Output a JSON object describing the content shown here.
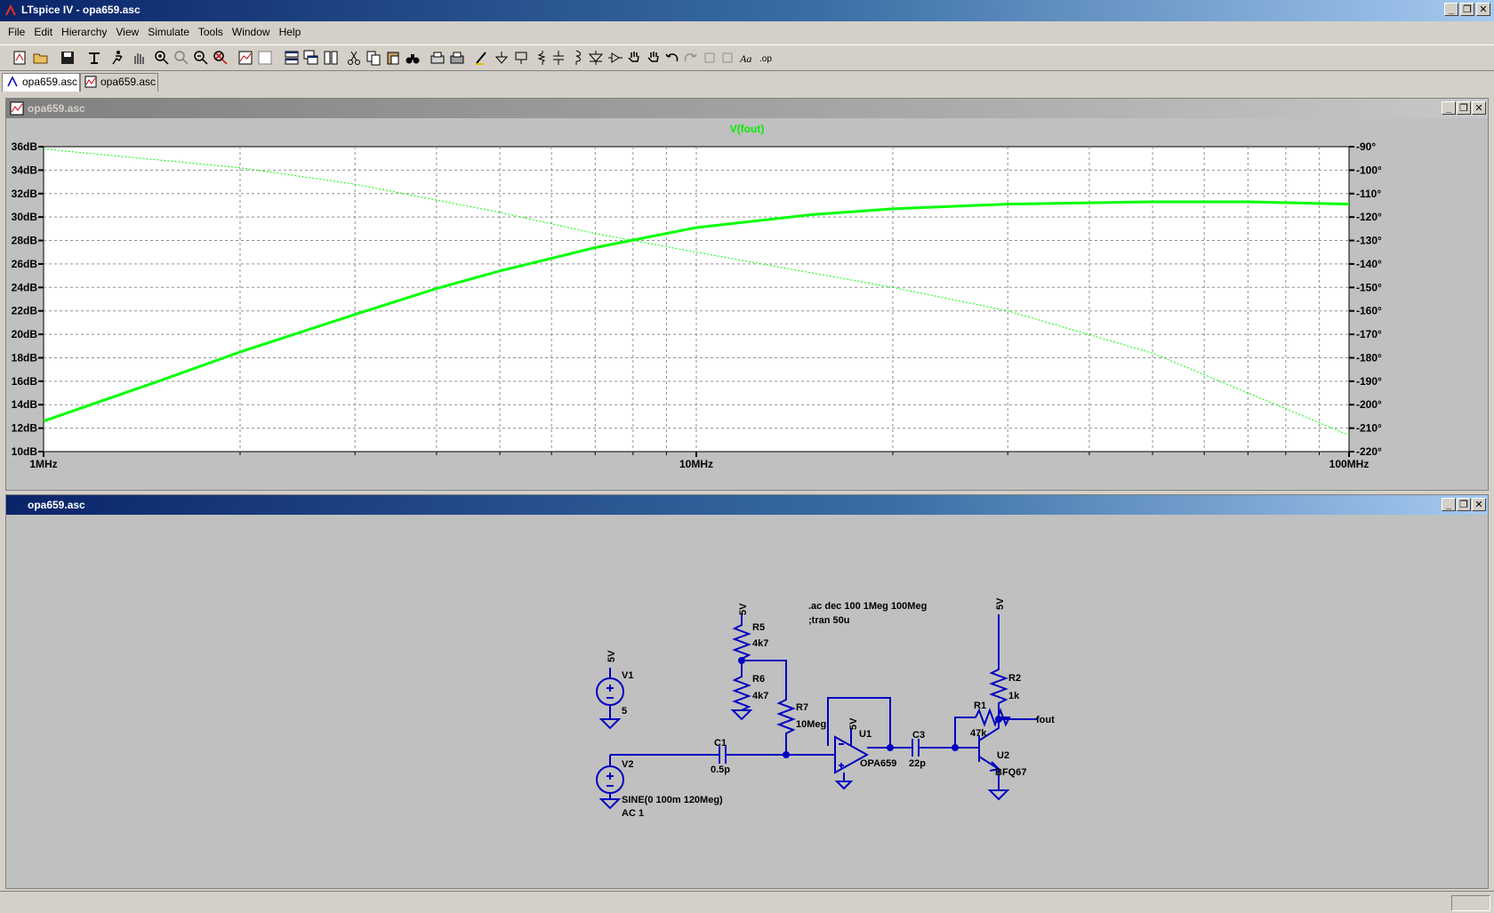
{
  "window": {
    "title": "LTspice IV - opa659.asc"
  },
  "menu": [
    "File",
    "Edit",
    "Hierarchy",
    "View",
    "Simulate",
    "Tools",
    "Window",
    "Help"
  ],
  "tabs": [
    {
      "label": "opa659.asc",
      "icon": "schematic-icon"
    },
    {
      "label": "opa659.asc",
      "icon": "waveform-icon"
    }
  ],
  "waveform_pane": {
    "title": "opa659.asc"
  },
  "schematic_pane": {
    "title": "opa659.asc"
  },
  "chart_data": {
    "type": "line",
    "title": "V(fout)",
    "x_scale": "log",
    "xlim": [
      1000000,
      100000000
    ],
    "x_tick_labels": [
      "1MHz",
      "10MHz",
      "100MHz"
    ],
    "left_axis": {
      "ylim": [
        10,
        36
      ],
      "tick_labels": [
        "36dB",
        "34dB",
        "32dB",
        "30dB",
        "28dB",
        "26dB",
        "24dB",
        "22dB",
        "20dB",
        "18dB",
        "16dB",
        "14dB",
        "12dB",
        "10dB"
      ]
    },
    "right_axis": {
      "ylim": [
        -220,
        -90
      ],
      "tick_labels": [
        "-90°",
        "-100°",
        "-110°",
        "-120°",
        "-130°",
        "-140°",
        "-150°",
        "-160°",
        "-170°",
        "-180°",
        "-190°",
        "-200°",
        "-210°",
        "-220°"
      ]
    },
    "grid": true,
    "background": "#ffffff",
    "series": [
      {
        "name": "V(fout)",
        "quantity": "magnitude",
        "color": "#00ff00",
        "style": "solid",
        "x": [
          1000000,
          1500000,
          2000000,
          3000000,
          4000000,
          5000000,
          7000000,
          10000000,
          15000000,
          20000000,
          30000000,
          50000000,
          70000000,
          100000000
        ],
        "y": [
          12.6,
          16.0,
          18.5,
          21.7,
          23.9,
          25.4,
          27.4,
          29.1,
          30.2,
          30.7,
          31.1,
          31.3,
          31.3,
          31.1
        ]
      },
      {
        "name": "V(fout)",
        "quantity": "phase",
        "color": "#00ff00",
        "style": "dotted",
        "x": [
          1000000,
          2000000,
          3000000,
          5000000,
          7000000,
          10000000,
          20000000,
          30000000,
          50000000,
          70000000,
          100000000
        ],
        "y": [
          -91,
          -99,
          -106,
          -118,
          -127,
          -135,
          -150,
          -160,
          -178,
          -195,
          -213
        ]
      }
    ]
  },
  "schematic": {
    "wire_color": "#0000c0",
    "directives": [
      ".ac dec 100 1Meg 100Meg",
      ";tran 50u"
    ],
    "labels": {
      "r5_ref": "R5",
      "r5_val": "4k7",
      "r6_ref": "R6",
      "r6_val": "4k7",
      "r7_ref": "R7",
      "r7_val": "10Meg",
      "r2_ref": "R2",
      "r2_val": "1k",
      "r1_ref": "R1",
      "r1_val": "47k",
      "c1_ref": "C1",
      "c1_val": "0.5p",
      "c3_ref": "C3",
      "c3_val": "22p",
      "v1_ref": "V1",
      "v1_val": "5",
      "v2_ref": "V2",
      "v2_val1": "SINE(0 100m 120Meg)",
      "v2_val2": "AC 1",
      "u1_ref": "U1",
      "u1_val": "OPA659",
      "u2_ref": "U2",
      "u2_val": "BFQ67",
      "net_fout": "fout",
      "pwr_5v": "5V"
    }
  }
}
